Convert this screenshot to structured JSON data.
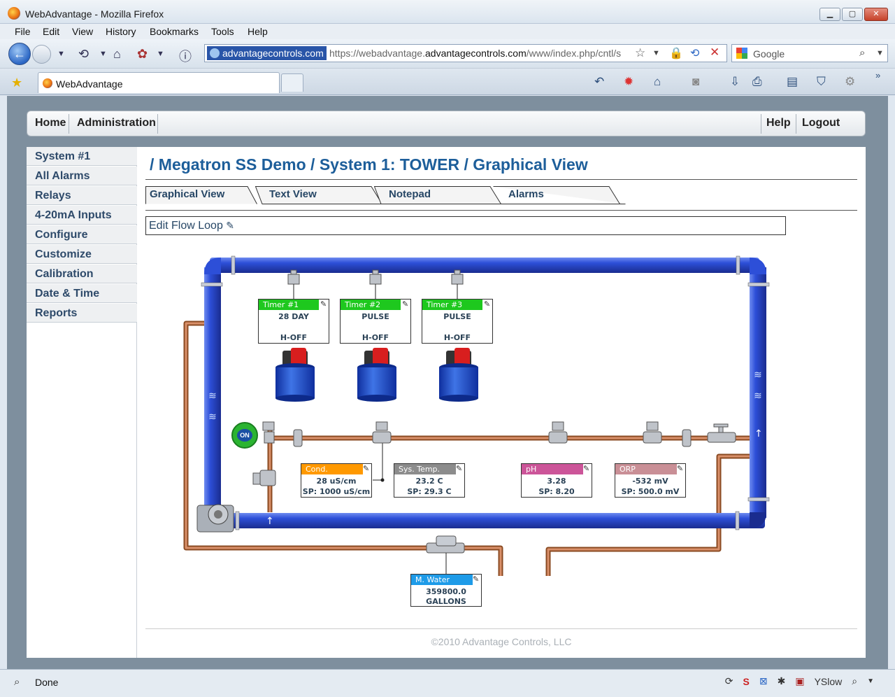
{
  "window": {
    "title": "WebAdvantage - Mozilla Firefox"
  },
  "menu": [
    "File",
    "Edit",
    "View",
    "History",
    "Bookmarks",
    "Tools",
    "Help"
  ],
  "url": {
    "identity": "advantagecontrols.com",
    "prefix": "https://webadvantage.",
    "domain": "advantagecontrols.com",
    "path": "/www/index.php/cntl/s"
  },
  "search": {
    "placeholder": "Google"
  },
  "tab": {
    "label": "WebAdvantage"
  },
  "status": {
    "text": "Done",
    "yslow": "YSlow"
  },
  "topnav": {
    "home": "Home",
    "admin": "Administration",
    "help": "Help",
    "logout": "Logout"
  },
  "sidebar": [
    "System #1",
    "All Alarms",
    "Relays",
    "4-20mA Inputs",
    "Configure",
    "Customize",
    "Calibration",
    "Date & Time",
    "Reports"
  ],
  "breadcrumb": "/ Megatron SS Demo / System 1:  TOWER  / Graphical View",
  "tabs": [
    "Graphical View",
    "Text View",
    "Notepad",
    "Alarms"
  ],
  "edit_flow_loop": "Edit Flow Loop",
  "on_label": "ON",
  "timers": [
    {
      "name": "Timer #1",
      "value": "28 DAY",
      "mode": "H-OFF"
    },
    {
      "name": "Timer #2",
      "value": "PULSE",
      "mode": "H-OFF"
    },
    {
      "name": "Timer #3",
      "value": "PULSE",
      "mode": "H-OFF"
    }
  ],
  "sensors": [
    {
      "name": "Cond.",
      "value": "28 uS/cm",
      "setpoint": "SP: 1000 uS/cm",
      "color": "#ff9900"
    },
    {
      "name": "Sys. Temp.",
      "value": "23.2 C",
      "setpoint": "SP: 29.3 C",
      "color": "#8c8c8c"
    },
    {
      "name": "pH",
      "value": "3.28",
      "setpoint": "SP: 8.20",
      "color": "#cc5599"
    },
    {
      "name": "ORP",
      "value": "-532 mV",
      "setpoint": "SP: 500.0 mV",
      "color": "#c98f96"
    }
  ],
  "meter": {
    "name": "M. Water",
    "value": "359800.0",
    "unit": "GALLONS",
    "color": "#1e9be8"
  },
  "timer_color": "#1ec81e",
  "footer": "©2010 Advantage Controls, LLC"
}
